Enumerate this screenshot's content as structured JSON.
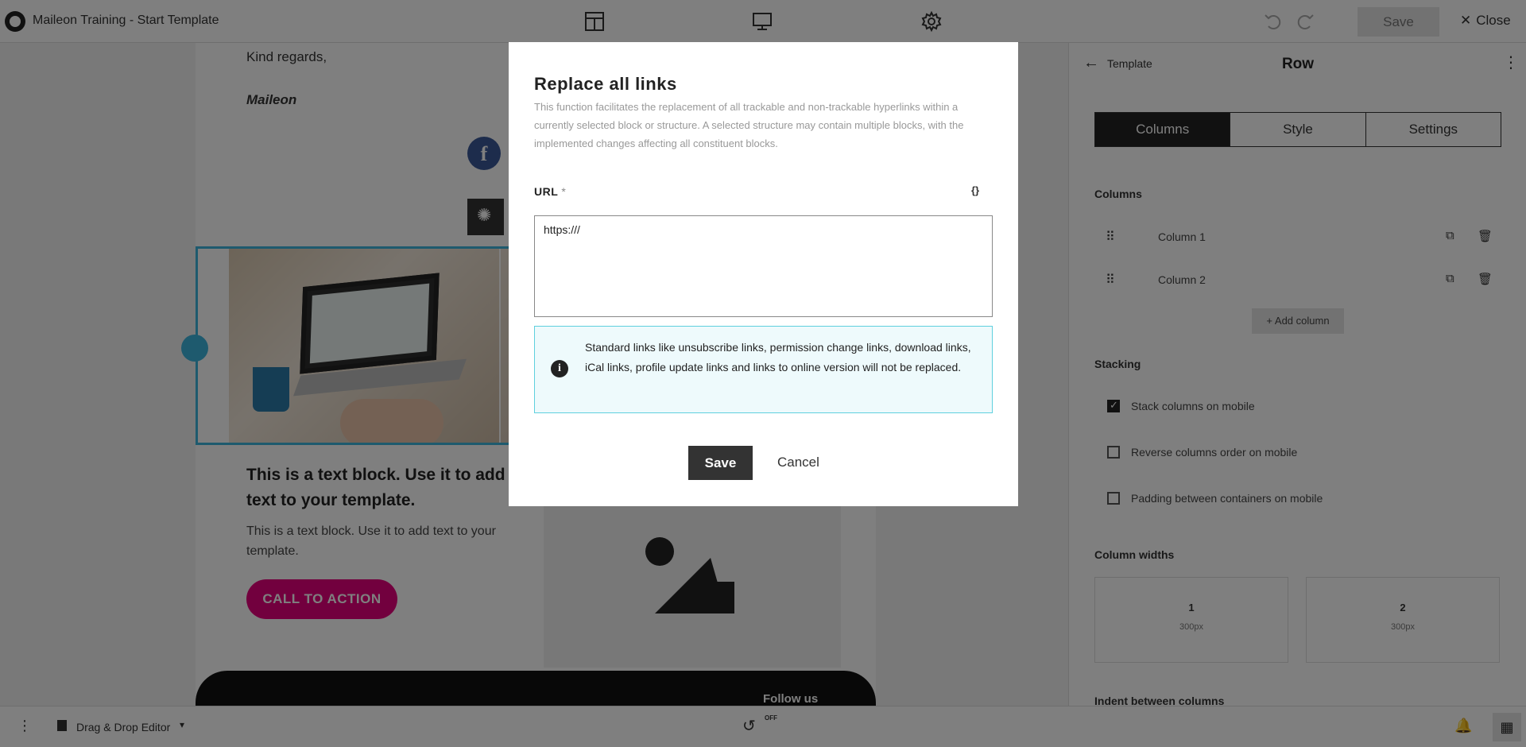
{
  "app": {
    "title": "Maileon Training - Start Template",
    "save_label": "Save",
    "close_label": "Close"
  },
  "email": {
    "greeting": "Kind regards,",
    "signature": "Maileon",
    "text_block_heading": "This is a text block. Use it to add text to your template.",
    "text_block_body": "This is a text block. Use it to add text to your template.",
    "cta_label": "CALL TO ACTION",
    "footer_follow": "Follow us"
  },
  "panel": {
    "back_label": "Template",
    "title": "Row",
    "tabs": [
      "Columns",
      "Style",
      "Settings"
    ],
    "columns_heading": "Columns",
    "columns": [
      "Column 1",
      "Column 2"
    ],
    "add_column_label": "+ Add column",
    "stacking_heading": "Stacking",
    "options": [
      {
        "label": "Stack columns on mobile",
        "checked": true
      },
      {
        "label": "Reverse columns order on mobile",
        "checked": false
      },
      {
        "label": "Padding between containers on mobile",
        "checked": false
      }
    ],
    "widths_heading": "Column widths",
    "widths": [
      {
        "num": "1",
        "px": "300px"
      },
      {
        "num": "2",
        "px": "300px"
      }
    ],
    "indent_heading": "Indent between columns"
  },
  "bottombar": {
    "editor_label": "Drag & Drop Editor",
    "history_state": "OFF"
  },
  "modal": {
    "title": "Replace all links",
    "description": "This function facilitates the replacement of all trackable and non-trackable hyperlinks within a currently selected block or structure. A selected structure may contain multiple blocks, with the implemented changes affecting all constituent blocks.",
    "url_label": "URL",
    "url_required": "*",
    "variable_icon": "{}",
    "url_value": "https:///",
    "info_text": "Standard links like unsubscribe links, permission change links, download links, iCal links, profile update links and links to online version will not be replaced.",
    "save_label": "Save",
    "cancel_label": "Cancel"
  }
}
